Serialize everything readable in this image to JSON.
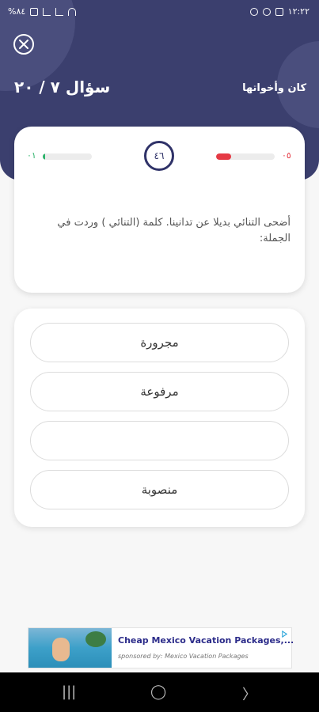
{
  "status_bar": {
    "time": "١٢:٢٢",
    "battery": "%٨٤",
    "left_icons": [
      "battery-icon",
      "signal-icon",
      "signal-icon",
      "wifi-icon",
      "data-icon"
    ],
    "right_icons": [
      "messenger-icon",
      "whatsapp-icon",
      "gallery-icon"
    ]
  },
  "header": {
    "question_counter": "سؤال ٧ / ٢٠",
    "topic": "كان وأخواتها",
    "bg_color": "#3b3f6e"
  },
  "progress": {
    "timer": "٤٦",
    "correct_score": "٠١",
    "correct_fraction": 0.05,
    "correct_color": "#2db36b",
    "wrong_score": "٠٥",
    "wrong_fraction": 0.25,
    "wrong_color": "#e53a45"
  },
  "question": {
    "text": "أضحى التنائي بديلا عن تدانينا. كلمة (التنائي ) وردت في الجملة:"
  },
  "options": [
    {
      "label": "مجرورة"
    },
    {
      "label": "مرفوعة"
    },
    {
      "label": ""
    },
    {
      "label": "منصوبة"
    }
  ],
  "ad": {
    "title": "Cheap Mexico Vacation Packages,...",
    "sponsor": "sponsored by: Mexico Vacation Packages"
  },
  "nav": {
    "recent": "|||",
    "home": "◯",
    "back": "〉"
  }
}
